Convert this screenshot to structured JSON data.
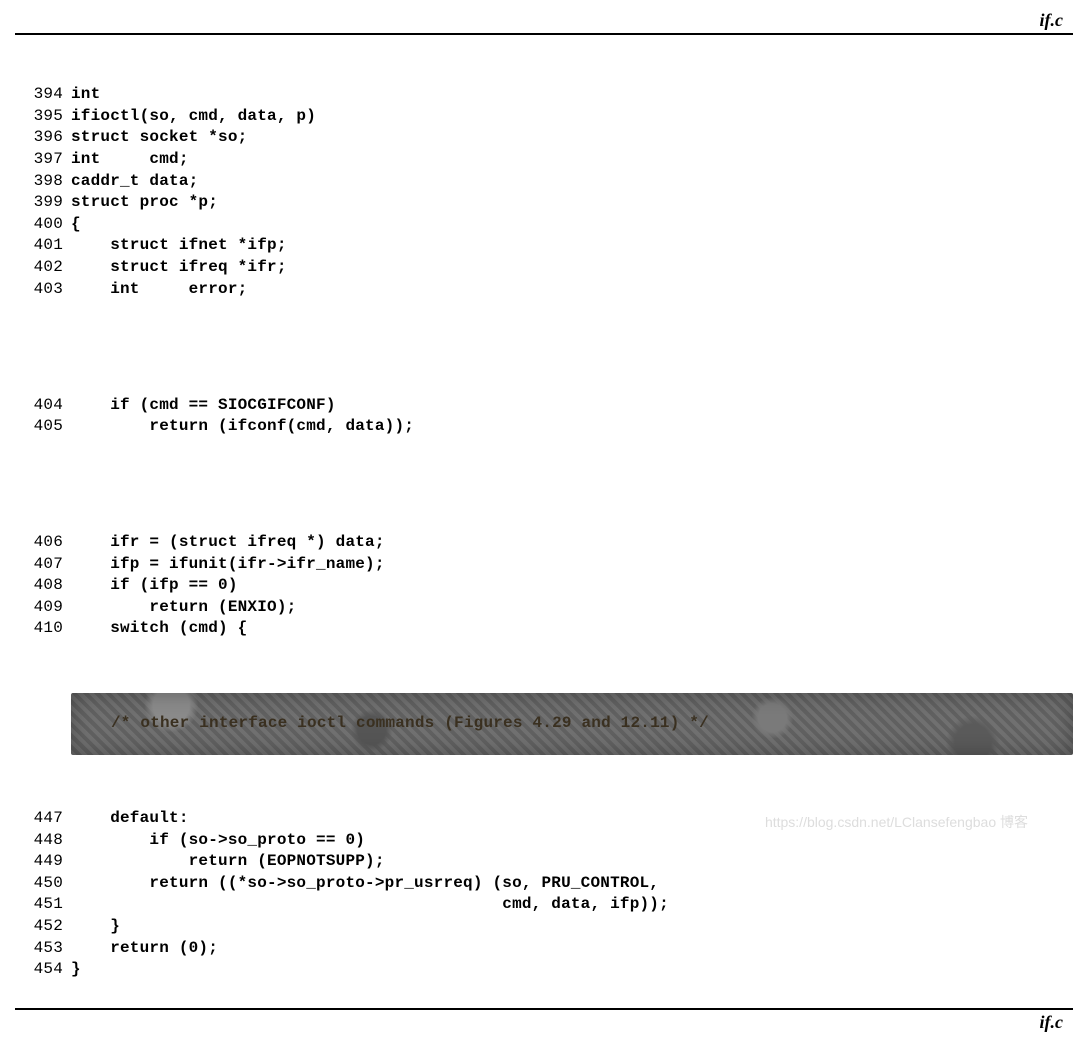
{
  "filename_top": "if.c",
  "filename_bottom": "if.c",
  "ellipsis_text": "/* other interface ioctl commands (Figures 4.29 and 12.11) */",
  "watermark": "https://blog.csdn.net/LClansefengbao 博客",
  "lines_a": [
    {
      "n": "394",
      "c": "int"
    },
    {
      "n": "395",
      "c": "ifioctl(so, cmd, data, p)"
    },
    {
      "n": "396",
      "c": "struct socket *so;"
    },
    {
      "n": "397",
      "c": "int     cmd;"
    },
    {
      "n": "398",
      "c": "caddr_t data;"
    },
    {
      "n": "399",
      "c": "struct proc *p;"
    },
    {
      "n": "400",
      "c": "{"
    },
    {
      "n": "401",
      "c": "    struct ifnet *ifp;"
    },
    {
      "n": "402",
      "c": "    struct ifreq *ifr;"
    },
    {
      "n": "403",
      "c": "    int     error;"
    }
  ],
  "lines_b": [
    {
      "n": "404",
      "c": "    if (cmd == SIOCGIFCONF)"
    },
    {
      "n": "405",
      "c": "        return (ifconf(cmd, data));"
    }
  ],
  "lines_c": [
    {
      "n": "406",
      "c": "    ifr = (struct ifreq *) data;"
    },
    {
      "n": "407",
      "c": "    ifp = ifunit(ifr->ifr_name);"
    },
    {
      "n": "408",
      "c": "    if (ifp == 0)"
    },
    {
      "n": "409",
      "c": "        return (ENXIO);"
    },
    {
      "n": "410",
      "c": "    switch (cmd) {"
    }
  ],
  "lines_d": [
    {
      "n": "447",
      "c": "    default:"
    },
    {
      "n": "448",
      "c": "        if (so->so_proto == 0)"
    },
    {
      "n": "449",
      "c": "            return (EOPNOTSUPP);"
    },
    {
      "n": "450",
      "c": "        return ((*so->so_proto->pr_usrreq) (so, PRU_CONTROL,"
    },
    {
      "n": "451",
      "c": "                                            cmd, data, ifp));"
    },
    {
      "n": "452",
      "c": "    }"
    },
    {
      "n": "453",
      "c": "    return (0);"
    },
    {
      "n": "454",
      "c": "}"
    }
  ]
}
